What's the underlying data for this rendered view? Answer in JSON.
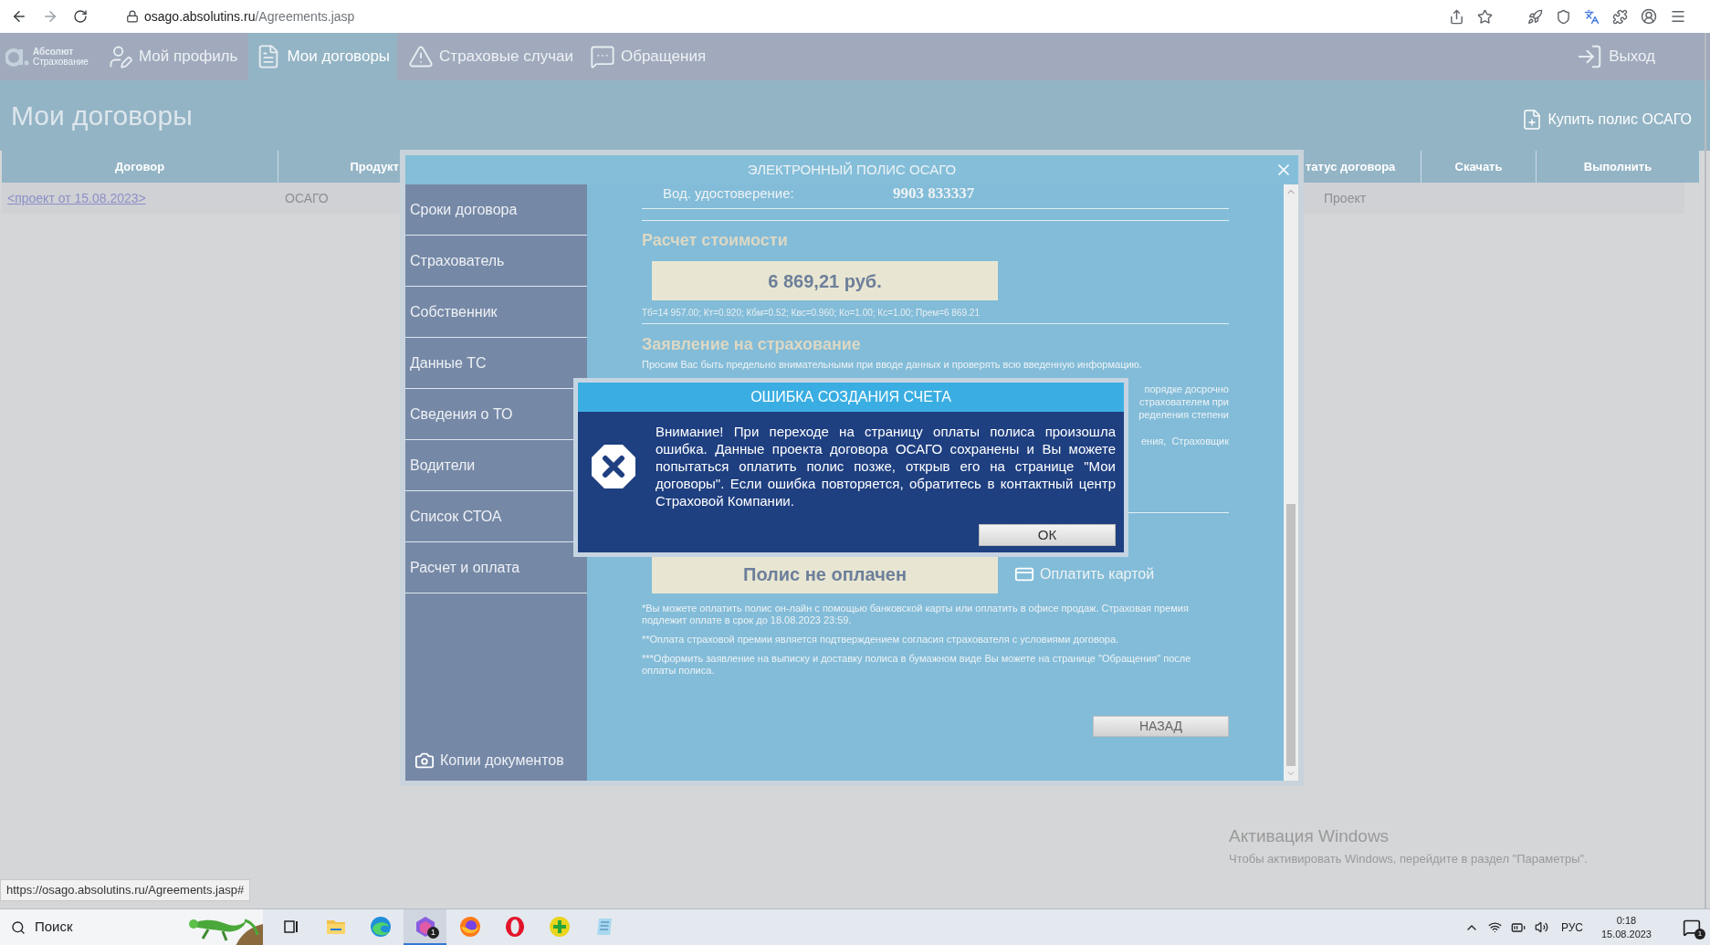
{
  "browser": {
    "url_domain": "osago.absolutins.ru",
    "url_path": "/Agreements.jasp",
    "status_url": "https://osago.absolutins.ru/Agreements.jasp#"
  },
  "site_nav": {
    "logo_name": "Абсолют",
    "logo_sub": "Страхование",
    "logout": "Выход",
    "tabs": [
      {
        "label": "Мой профиль",
        "selected": false
      },
      {
        "label": "Мои договоры",
        "selected": true
      },
      {
        "label": "Страховые случаи",
        "selected": false
      },
      {
        "label": "Обращения",
        "selected": false
      }
    ]
  },
  "page": {
    "title": "Мои договоры",
    "buy_link": "Купить полис ОСАГО"
  },
  "table": {
    "columns": [
      "Договор",
      "Продукт",
      "татус договора",
      "Скачать",
      "Выполнить"
    ],
    "rows": [
      {
        "contract": "<проект от 15.08.2023>",
        "product": "ОСАГО",
        "status": "Проект"
      }
    ]
  },
  "modal": {
    "title": "ЭЛЕКТРОННЫЙ ПОЛИС ОСАГО",
    "sidebar": [
      "Сроки договора",
      "Страхователь",
      "Собственник",
      "Данные ТС",
      "Сведения о ТО",
      "Водители",
      "Список СТОА",
      "Расчет и оплата"
    ],
    "documents_link": "Копии документов",
    "license_label": "Вод. удостоверение:",
    "license_number": "9903 833337",
    "cost_heading": "Расчет стоимости",
    "price": "6 869,21 руб.",
    "formula": "Тб=14 957.00; Кт=0.920; Кбм=0.52; Квс=0.960; Ко=1.00; Кс=1.00; Прем=6 869.21",
    "application_heading": "Заявление на страхование",
    "application_intro": "Просим Вас быть предельно внимательными при вводе данных и проверять всю введенную информацию.",
    "partial_lines": [
      "порядке досрочно",
      "страхователем при",
      "ределения степени",
      "ения,  Страховщик"
    ],
    "payment_status": "Полис не оплачен",
    "pay_link": "Оплатить картой",
    "notes": [
      "*Вы можете оплатить полис он-лайн с помощью банковской карты или оплатить в офисе продаж. Страховая премия подлежит оплате в срок до 18.08.2023 23:59.",
      "**Оплата страховой премии является подтверждением согласия страхователя с условиями договора.",
      "***Оформить заявление на выписку и доставку полиса в бумажном виде Вы можете на странице \"Обращения\" после оплаты полиса."
    ],
    "back_button": "НАЗАД"
  },
  "error_dialog": {
    "title": "ОШИБКА СОЗДАНИЯ СЧЕТА",
    "message": "Внимание! При переходе на страницу оплаты полиса произошла ошибка. Данные проекта договора ОСАГО сохранены и Вы можете попытаться оплатить полис позже, открыв его на странице \"Мои договоры\". Если ошибка повторяется, обратитесь в контактный центр Страховой Компании.",
    "ok_button": "ОК"
  },
  "watermark": {
    "title": "Активация Windows",
    "text": "Чтобы активировать Windows, перейдите в раздел \"Параметры\"."
  },
  "taskbar": {
    "search": "Поиск",
    "apps": [
      {
        "kind": "taskview",
        "selected": false
      },
      {
        "kind": "folder",
        "selected": false
      },
      {
        "kind": "wave",
        "selected": false
      },
      {
        "kind": "hexagon",
        "badge": "1",
        "selected": true
      },
      {
        "kind": "flame",
        "selected": false
      },
      {
        "kind": "ring",
        "selected": false
      },
      {
        "kind": "plus",
        "selected": false
      },
      {
        "kind": "notepad",
        "selected": false
      }
    ],
    "language": "РУС",
    "time": "0:18",
    "date": "15.08.2023",
    "notifications": "1"
  }
}
